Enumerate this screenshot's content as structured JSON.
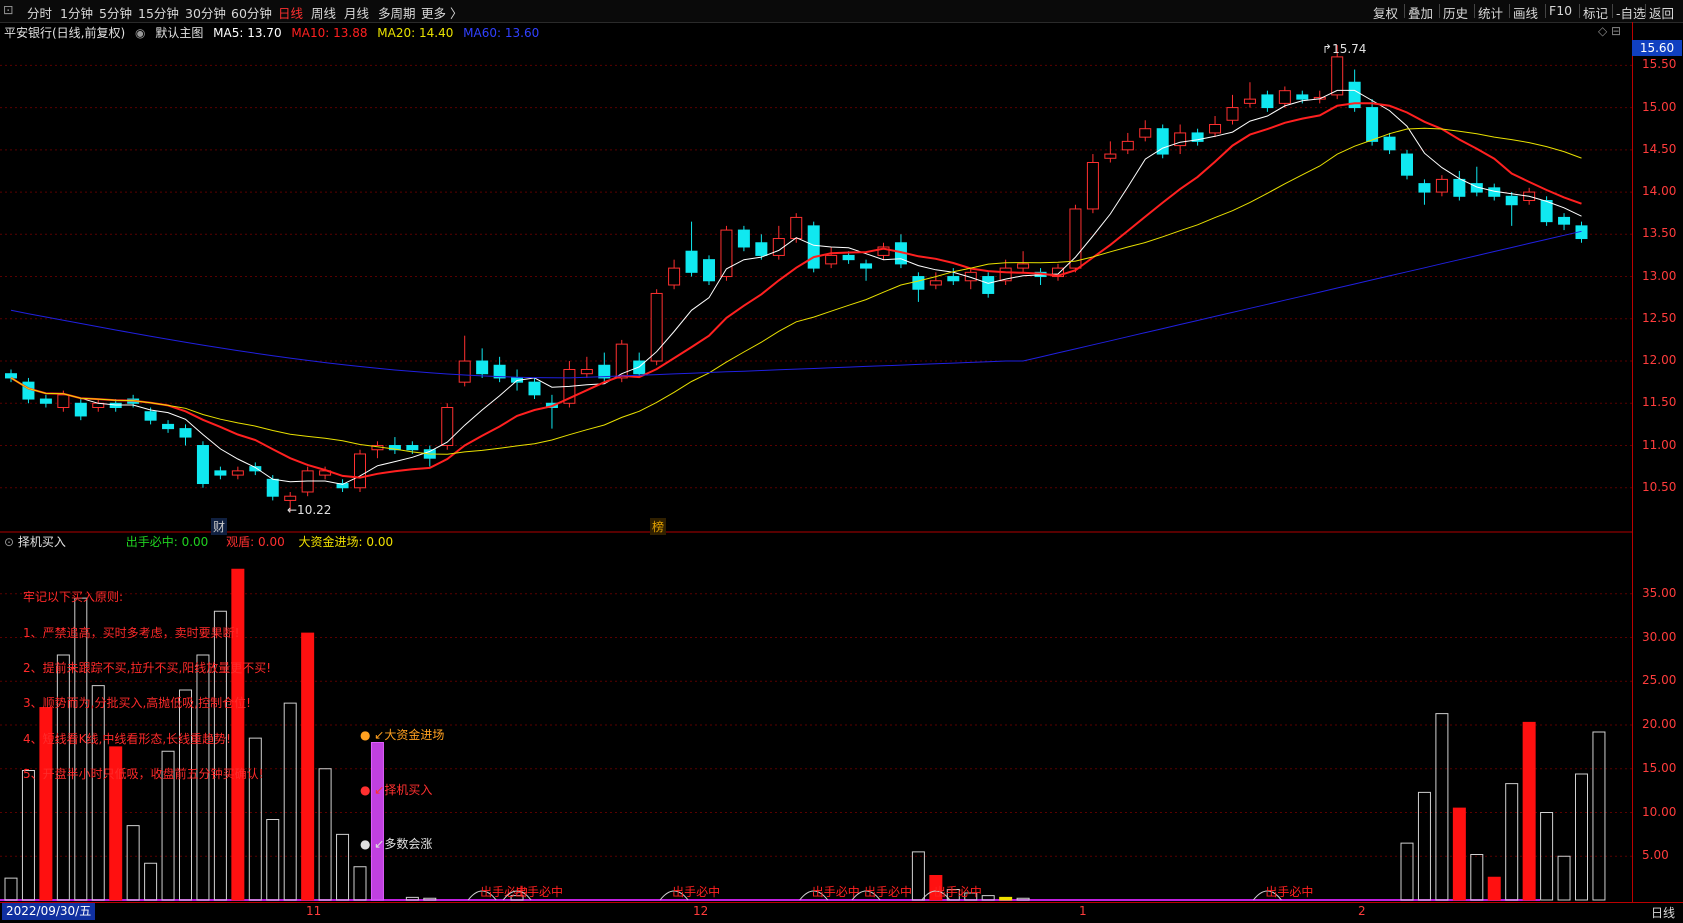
{
  "toolbar": {
    "periods": [
      "分时",
      "1分钟",
      "5分钟",
      "15分钟",
      "30分钟",
      "60分钟",
      "日线",
      "周线",
      "月线",
      "多周期",
      "更多 〉"
    ],
    "active": "日线",
    "right_items": [
      "复权",
      "叠加",
      "历史",
      "统计",
      "画线",
      "F10",
      "标记",
      "-自选",
      "返回"
    ]
  },
  "main_legend": {
    "title": "平安银行(日线,前复权)",
    "template": "默认主图",
    "ma5": "MA5: 13.70",
    "ma10": "MA10: 13.88",
    "ma20": "MA20: 14.40",
    "ma60": "MA60: 13.60",
    "colors": {
      "ma5": "#ffffff",
      "ma10": "#ff2020",
      "ma20": "#e8e000",
      "ma60": "#2020ff"
    }
  },
  "price_badge": "15.60",
  "annotations": {
    "high": "15.74",
    "low": "←10.22",
    "cai": "财",
    "bang": "榜"
  },
  "indicator_legend": {
    "name": "择机买入",
    "l1": "出手必中: 0.00",
    "l2": "观盾: 0.00",
    "l3": "大资金进场: 0.00"
  },
  "rules": [
    "牢记以下买入原则:",
    "1、严禁追高，买时多考虑，卖时要果断!",
    "2、提前未跟踪不买,拉升不买,阳线放量更不买!",
    "3、顺势而为,分批买入,高抛低吸,控制仓位!",
    "4、短线看K线,中线看形态,长线重趋势!",
    "5、开盘半小时只低吸，收盘前五分钟买确认!"
  ],
  "ind_markers": [
    "大资金进场",
    "择机买入",
    "多数会涨"
  ],
  "signal_label": "出手必中",
  "bottom": {
    "date": "2022/09/30/五",
    "months": [
      "11",
      "12",
      "1",
      "2"
    ],
    "period": "日线"
  },
  "chart_data": [
    {
      "type": "candlestick",
      "title": "平安银行(日线,前复权)",
      "ylim": [
        10.0,
        15.8
      ],
      "yticks": [
        "15.50",
        "15.00",
        "14.50",
        "14.00",
        "13.50",
        "13.00",
        "12.50",
        "12.00",
        "11.50",
        "11.00",
        "10.50"
      ],
      "candles": [
        [
          11.85,
          11.8,
          11.9,
          11.75
        ],
        [
          11.75,
          11.55,
          11.8,
          11.5
        ],
        [
          11.55,
          11.5,
          11.6,
          11.45
        ],
        [
          11.45,
          11.6,
          11.65,
          11.4
        ],
        [
          11.5,
          11.35,
          11.55,
          11.3
        ],
        [
          11.45,
          11.5,
          11.55,
          11.4
        ],
        [
          11.5,
          11.45,
          11.55,
          11.4
        ],
        [
          11.55,
          11.5,
          11.6,
          11.45
        ],
        [
          11.4,
          11.3,
          11.45,
          11.25
        ],
        [
          11.25,
          11.2,
          11.3,
          11.15
        ],
        [
          11.2,
          11.1,
          11.25,
          11.0
        ],
        [
          11.0,
          10.55,
          11.05,
          10.5
        ],
        [
          10.7,
          10.65,
          10.75,
          10.6
        ],
        [
          10.65,
          10.7,
          10.75,
          10.6
        ],
        [
          10.75,
          10.7,
          10.8,
          10.65
        ],
        [
          10.6,
          10.4,
          10.65,
          10.35
        ],
        [
          10.35,
          10.4,
          10.45,
          10.22
        ],
        [
          10.45,
          10.7,
          10.75,
          10.4
        ],
        [
          10.65,
          10.7,
          10.75,
          10.6
        ],
        [
          10.55,
          10.5,
          10.6,
          10.45
        ],
        [
          10.5,
          10.9,
          10.95,
          10.45
        ],
        [
          10.95,
          11.0,
          11.05,
          10.85
        ],
        [
          11.0,
          10.95,
          11.1,
          10.9
        ],
        [
          11.0,
          10.95,
          11.05,
          10.9
        ],
        [
          10.95,
          10.85,
          11.0,
          10.75
        ],
        [
          11.0,
          11.45,
          11.5,
          10.95
        ],
        [
          11.75,
          12.0,
          12.3,
          11.7
        ],
        [
          12.0,
          11.85,
          12.15,
          11.8
        ],
        [
          11.95,
          11.8,
          12.05,
          11.75
        ],
        [
          11.8,
          11.75,
          11.9,
          11.65
        ],
        [
          11.75,
          11.6,
          11.8,
          11.55
        ],
        [
          11.5,
          11.45,
          11.6,
          11.2
        ],
        [
          11.5,
          11.9,
          12.0,
          11.45
        ],
        [
          11.85,
          11.9,
          12.05,
          11.8
        ],
        [
          11.95,
          11.8,
          12.1,
          11.75
        ],
        [
          11.8,
          12.2,
          12.25,
          11.75
        ],
        [
          12.0,
          11.85,
          12.1,
          11.8
        ],
        [
          12.0,
          12.8,
          12.85,
          11.95
        ],
        [
          12.9,
          13.1,
          13.2,
          12.85
        ],
        [
          13.3,
          13.05,
          13.65,
          13.0
        ],
        [
          13.2,
          12.95,
          13.25,
          12.9
        ],
        [
          13.0,
          13.55,
          13.6,
          12.95
        ],
        [
          13.55,
          13.35,
          13.6,
          13.3
        ],
        [
          13.4,
          13.25,
          13.5,
          13.2
        ],
        [
          13.25,
          13.45,
          13.6,
          13.2
        ],
        [
          13.45,
          13.7,
          13.75,
          13.4
        ],
        [
          13.6,
          13.1,
          13.65,
          13.05
        ],
        [
          13.15,
          13.25,
          13.35,
          13.1
        ],
        [
          13.25,
          13.2,
          13.3,
          13.15
        ],
        [
          13.15,
          13.1,
          13.2,
          12.95
        ],
        [
          13.25,
          13.35,
          13.4,
          13.2
        ],
        [
          13.4,
          13.15,
          13.5,
          13.1
        ],
        [
          13.0,
          12.85,
          13.05,
          12.7
        ],
        [
          12.9,
          12.95,
          13.05,
          12.85
        ],
        [
          13.0,
          12.95,
          13.1,
          12.9
        ],
        [
          12.95,
          13.05,
          13.1,
          12.85
        ],
        [
          13.0,
          12.8,
          13.05,
          12.75
        ],
        [
          12.95,
          13.1,
          13.2,
          12.9
        ],
        [
          13.1,
          13.15,
          13.3,
          13.05
        ],
        [
          13.05,
          13.0,
          13.1,
          12.9
        ],
        [
          13.0,
          13.1,
          13.15,
          12.95
        ],
        [
          13.1,
          13.8,
          13.85,
          13.05
        ],
        [
          13.8,
          14.35,
          14.45,
          13.75
        ],
        [
          14.4,
          14.45,
          14.6,
          14.35
        ],
        [
          14.5,
          14.6,
          14.7,
          14.45
        ],
        [
          14.65,
          14.75,
          14.85,
          14.6
        ],
        [
          14.75,
          14.45,
          14.8,
          14.4
        ],
        [
          14.55,
          14.7,
          14.8,
          14.45
        ],
        [
          14.7,
          14.6,
          14.75,
          14.55
        ],
        [
          14.7,
          14.8,
          14.9,
          14.65
        ],
        [
          14.85,
          15.0,
          15.15,
          14.8
        ],
        [
          15.05,
          15.1,
          15.3,
          15.0
        ],
        [
          15.15,
          15.0,
          15.2,
          14.95
        ],
        [
          15.05,
          15.2,
          15.25,
          15.0
        ],
        [
          15.15,
          15.1,
          15.2,
          15.05
        ],
        [
          15.1,
          15.12,
          15.2,
          15.05
        ],
        [
          15.15,
          15.6,
          15.74,
          15.1
        ],
        [
          15.3,
          15.0,
          15.45,
          14.95
        ],
        [
          15.0,
          14.6,
          15.1,
          14.55
        ],
        [
          14.65,
          14.5,
          14.7,
          14.45
        ],
        [
          14.45,
          14.2,
          14.5,
          14.15
        ],
        [
          14.1,
          14.0,
          14.15,
          13.85
        ],
        [
          14.0,
          14.15,
          14.2,
          13.95
        ],
        [
          14.15,
          13.95,
          14.25,
          13.9
        ],
        [
          14.1,
          14.0,
          14.3,
          13.95
        ],
        [
          14.05,
          13.95,
          14.1,
          13.9
        ],
        [
          13.95,
          13.85,
          14.0,
          13.6
        ],
        [
          13.9,
          14.0,
          14.05,
          13.85
        ],
        [
          13.9,
          13.65,
          13.95,
          13.6
        ],
        [
          13.7,
          13.62,
          13.75,
          13.55
        ],
        [
          13.6,
          13.45,
          13.65,
          13.4
        ]
      ]
    },
    {
      "type": "bar",
      "title": "择机买入",
      "ylim": [
        0,
        40
      ],
      "yticks": [
        "35.00",
        "30.00",
        "25.00",
        "20.00",
        "15.00",
        "10.00",
        "5.00"
      ],
      "bars": [
        [
          2.5,
          "o"
        ],
        [
          14.8,
          "o"
        ],
        [
          22,
          "r"
        ],
        [
          28,
          "o"
        ],
        [
          34.5,
          "o"
        ],
        [
          24.5,
          "o"
        ],
        [
          17.5,
          "r"
        ],
        [
          8.5,
          "o"
        ],
        [
          4.2,
          "o"
        ],
        [
          17,
          "o"
        ],
        [
          24,
          "o"
        ],
        [
          28,
          "o"
        ],
        [
          33,
          "o"
        ],
        [
          37.8,
          "r"
        ],
        [
          18.5,
          "o"
        ],
        [
          9.2,
          "o"
        ],
        [
          22.5,
          "o"
        ],
        [
          30.5,
          "r"
        ],
        [
          15,
          "o"
        ],
        [
          7.5,
          "o"
        ],
        [
          3.8,
          "o"
        ],
        [
          18,
          "m"
        ],
        [
          0,
          "n"
        ],
        [
          0.3,
          "o"
        ],
        [
          0.2,
          "o"
        ],
        [
          0,
          "n"
        ],
        [
          0,
          "n"
        ],
        [
          0,
          "n"
        ],
        [
          0,
          "n"
        ],
        [
          0.5,
          "o"
        ],
        [
          0,
          "n"
        ],
        [
          0,
          "n"
        ],
        [
          0,
          "n"
        ],
        [
          0,
          "n"
        ],
        [
          0,
          "n"
        ],
        [
          0,
          "n"
        ],
        [
          0,
          "n"
        ],
        [
          0,
          "n"
        ],
        [
          0,
          "n"
        ],
        [
          0,
          "n"
        ],
        [
          0,
          "n"
        ],
        [
          0,
          "n"
        ],
        [
          0,
          "n"
        ],
        [
          0,
          "n"
        ],
        [
          0,
          "n"
        ],
        [
          0,
          "n"
        ],
        [
          0,
          "n"
        ],
        [
          0,
          "n"
        ],
        [
          0,
          "n"
        ],
        [
          0,
          "n"
        ],
        [
          0,
          "n"
        ],
        [
          0,
          "n"
        ],
        [
          5.5,
          "o"
        ],
        [
          2.8,
          "r"
        ],
        [
          1.2,
          "o"
        ],
        [
          0.8,
          "o"
        ],
        [
          0.5,
          "o"
        ],
        [
          0.3,
          "y"
        ],
        [
          0.2,
          "o"
        ],
        [
          0,
          "n"
        ],
        [
          0,
          "n"
        ],
        [
          0,
          "n"
        ],
        [
          0,
          "n"
        ],
        [
          0,
          "n"
        ],
        [
          0,
          "n"
        ],
        [
          0,
          "n"
        ],
        [
          0,
          "n"
        ],
        [
          0,
          "n"
        ],
        [
          0,
          "n"
        ],
        [
          0,
          "n"
        ],
        [
          0,
          "n"
        ],
        [
          0,
          "n"
        ],
        [
          0,
          "n"
        ],
        [
          0,
          "n"
        ],
        [
          0,
          "n"
        ],
        [
          0,
          "n"
        ],
        [
          0,
          "n"
        ],
        [
          0,
          "n"
        ],
        [
          0,
          "n"
        ],
        [
          0,
          "n"
        ],
        [
          6.5,
          "o"
        ],
        [
          12.3,
          "o"
        ],
        [
          21.3,
          "o"
        ],
        [
          10.5,
          "r"
        ],
        [
          5.2,
          "o"
        ],
        [
          2.6,
          "r"
        ],
        [
          13.3,
          "o"
        ],
        [
          20.3,
          "r"
        ],
        [
          10,
          "o"
        ],
        [
          5,
          "o"
        ],
        [
          14.4,
          "o"
        ],
        [
          19.2,
          "o"
        ]
      ]
    }
  ]
}
